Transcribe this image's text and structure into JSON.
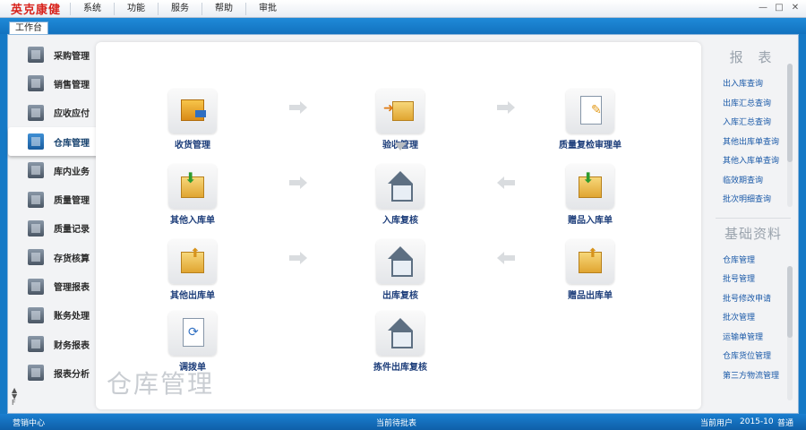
{
  "app": {
    "brand": "英克康健",
    "menu": [
      "系统",
      "功能",
      "服务",
      "帮助",
      "审批"
    ],
    "window_controls": [
      "—",
      "□",
      "✕"
    ]
  },
  "tab": {
    "label": "工作台"
  },
  "sidebar": {
    "items": [
      {
        "label": "采购管理",
        "icon": "purchase-icon"
      },
      {
        "label": "销售管理",
        "icon": "sales-icon"
      },
      {
        "label": "应收应付",
        "icon": "receivable-icon"
      },
      {
        "label": "仓库管理",
        "icon": "warehouse-icon",
        "active": true
      },
      {
        "label": "库内业务",
        "icon": "inventory-ops-icon"
      },
      {
        "label": "质量管理",
        "icon": "quality-icon"
      },
      {
        "label": "质量记录",
        "icon": "quality-record-icon"
      },
      {
        "label": "存货核算",
        "icon": "stock-accounting-icon"
      },
      {
        "label": "管理报表",
        "icon": "mgmt-report-icon"
      },
      {
        "label": "账务处理",
        "icon": "accounting-icon"
      },
      {
        "label": "财务报表",
        "icon": "finance-report-icon"
      },
      {
        "label": "报表分析",
        "icon": "report-analysis-icon"
      }
    ],
    "scroll_glyphs": [
      "▲",
      "▼",
      "F"
    ]
  },
  "workspace": {
    "watermark": "仓库管理",
    "nodes": {
      "receive": "收货管理",
      "inspect": "验收管理",
      "quality_review": "质量复检审理单",
      "other_in": "其他入库单",
      "in_review": "入库复核",
      "gift_in": "赠品入库单",
      "other_out": "其他出库单",
      "out_review": "出库复核",
      "gift_out": "赠品出库单",
      "transfer": "调拨单",
      "pick_out_review": "拣件出库复核"
    }
  },
  "right_panel": {
    "reports_title": "报 表",
    "reports": [
      "出入库查询",
      "出库汇总查询",
      "入库汇总查询",
      "其他出库单查询",
      "其他入库单查询",
      "临效期查询",
      "批次明细查询"
    ],
    "basic_title": "基础资料",
    "basic": [
      "仓库管理",
      "批号管理",
      "批号修改申请",
      "批次管理",
      "运输单管理",
      "仓库货位管理",
      "第三方物流管理"
    ]
  },
  "status": {
    "left": "营销中心",
    "center": "当前待批表",
    "user": "当前用户",
    "date": "2015-10",
    "mode": "普通"
  },
  "colors": {
    "brand": "#d8231c",
    "frame_blue": "#1579c6",
    "link_blue": "#1a59a8"
  }
}
